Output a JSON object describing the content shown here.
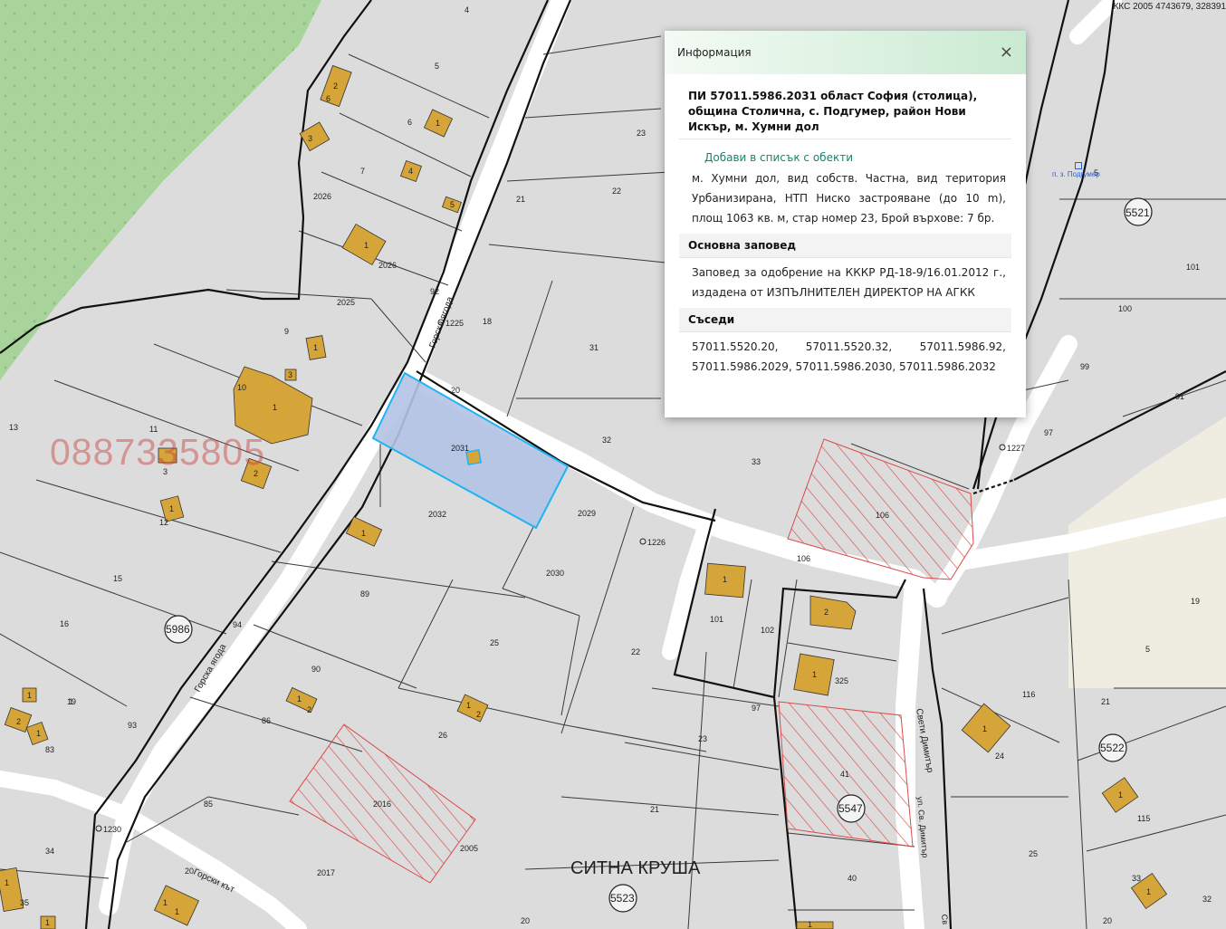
{
  "map": {
    "coords": "ККС 2005 4743679, 328391",
    "district_label": "СИТНА КРУША",
    "phone_watermark": "0887335805",
    "school_label": "п. з. Подгумер",
    "streets": {
      "gorska_yagoda_1": "Горска ягода",
      "gorska_yagoda_2": "Горска ягода",
      "gorski_kat": "Горски кът",
      "sveti_dimitar": "Свети Димитър",
      "ul_sv_dimitar": "ул. Св. Димитър",
      "sv_bottom": "Св"
    },
    "regions": [
      "5986",
      "5521",
      "5522",
      "5547",
      "5523"
    ],
    "geodetic_points": [
      "1225",
      "1226",
      "1227",
      "1230"
    ],
    "selected_parcel": "2031",
    "parcel_labels": [
      "4",
      "5",
      "6",
      "7",
      "2026",
      "2026",
      "2025",
      "9",
      "10",
      "11",
      "12",
      "13",
      "15",
      "16",
      "19",
      "83",
      "93",
      "18",
      "20",
      "21",
      "22",
      "23",
      "31",
      "32",
      "33",
      "2032",
      "2029",
      "2030",
      "89",
      "90",
      "86",
      "85",
      "34",
      "35",
      "25",
      "26",
      "2016",
      "2017",
      "2005",
      "22",
      "23",
      "21",
      "20",
      "97",
      "101",
      "102",
      "325",
      "41",
      "40",
      "106",
      "106",
      "116",
      "24",
      "115",
      "25",
      "33",
      "32",
      "20",
      "19",
      "21",
      "5",
      "5",
      "101",
      "100",
      "99",
      "97",
      "91",
      "92",
      "94",
      "20"
    ],
    "building_labels": [
      "2",
      "6",
      "3",
      "1",
      "4",
      "5",
      "1",
      "1",
      "1",
      "3",
      "3",
      "2",
      "1",
      "1",
      "1",
      "2",
      "1",
      "2",
      "1",
      "2",
      "1",
      "1",
      "1",
      "1",
      "1",
      "1",
      "2",
      "1",
      "1",
      "1",
      "1",
      "1",
      "1"
    ]
  },
  "popup": {
    "header_title": "Информация",
    "close_symbol": "×",
    "pi_title": "ПИ 57011.5986.2031 област София (столица), община Столична, с. Подгумер, район Нови Искър, м. Хумни дол",
    "add_link": "Добави в списък с обекти",
    "description": "м. Хумни дол, вид собств. Частна, вид територия Урбанизирана, НТП Ниско застрояване (до 10 m), площ 1063 кв. м, стар номер 23, Брой върхове: 7 бр.",
    "order_heading": "Основна заповед",
    "order_text": "Заповед за одобрение на КККР РД-18-9/16.01.2012 г., издадена от ИЗПЪЛНИТЕЛЕН ДИРЕКТОР НА АГКК",
    "neighbors_heading": "Съседи",
    "neighbors_text": "57011.5520.20, 57011.5520.32, 57011.5986.92, 57011.5986.2029, 57011.5986.2030, 57011.5986.2032"
  },
  "colors": {
    "parcel_fill": "#dcdcdc",
    "road_fill": "#ffffff",
    "green_area": "#a8d39a",
    "building": "#d6a53a",
    "selected_fill": "#b3c3e6",
    "selected_stroke": "#1fb4f0",
    "hatch": "#d94a4a"
  }
}
